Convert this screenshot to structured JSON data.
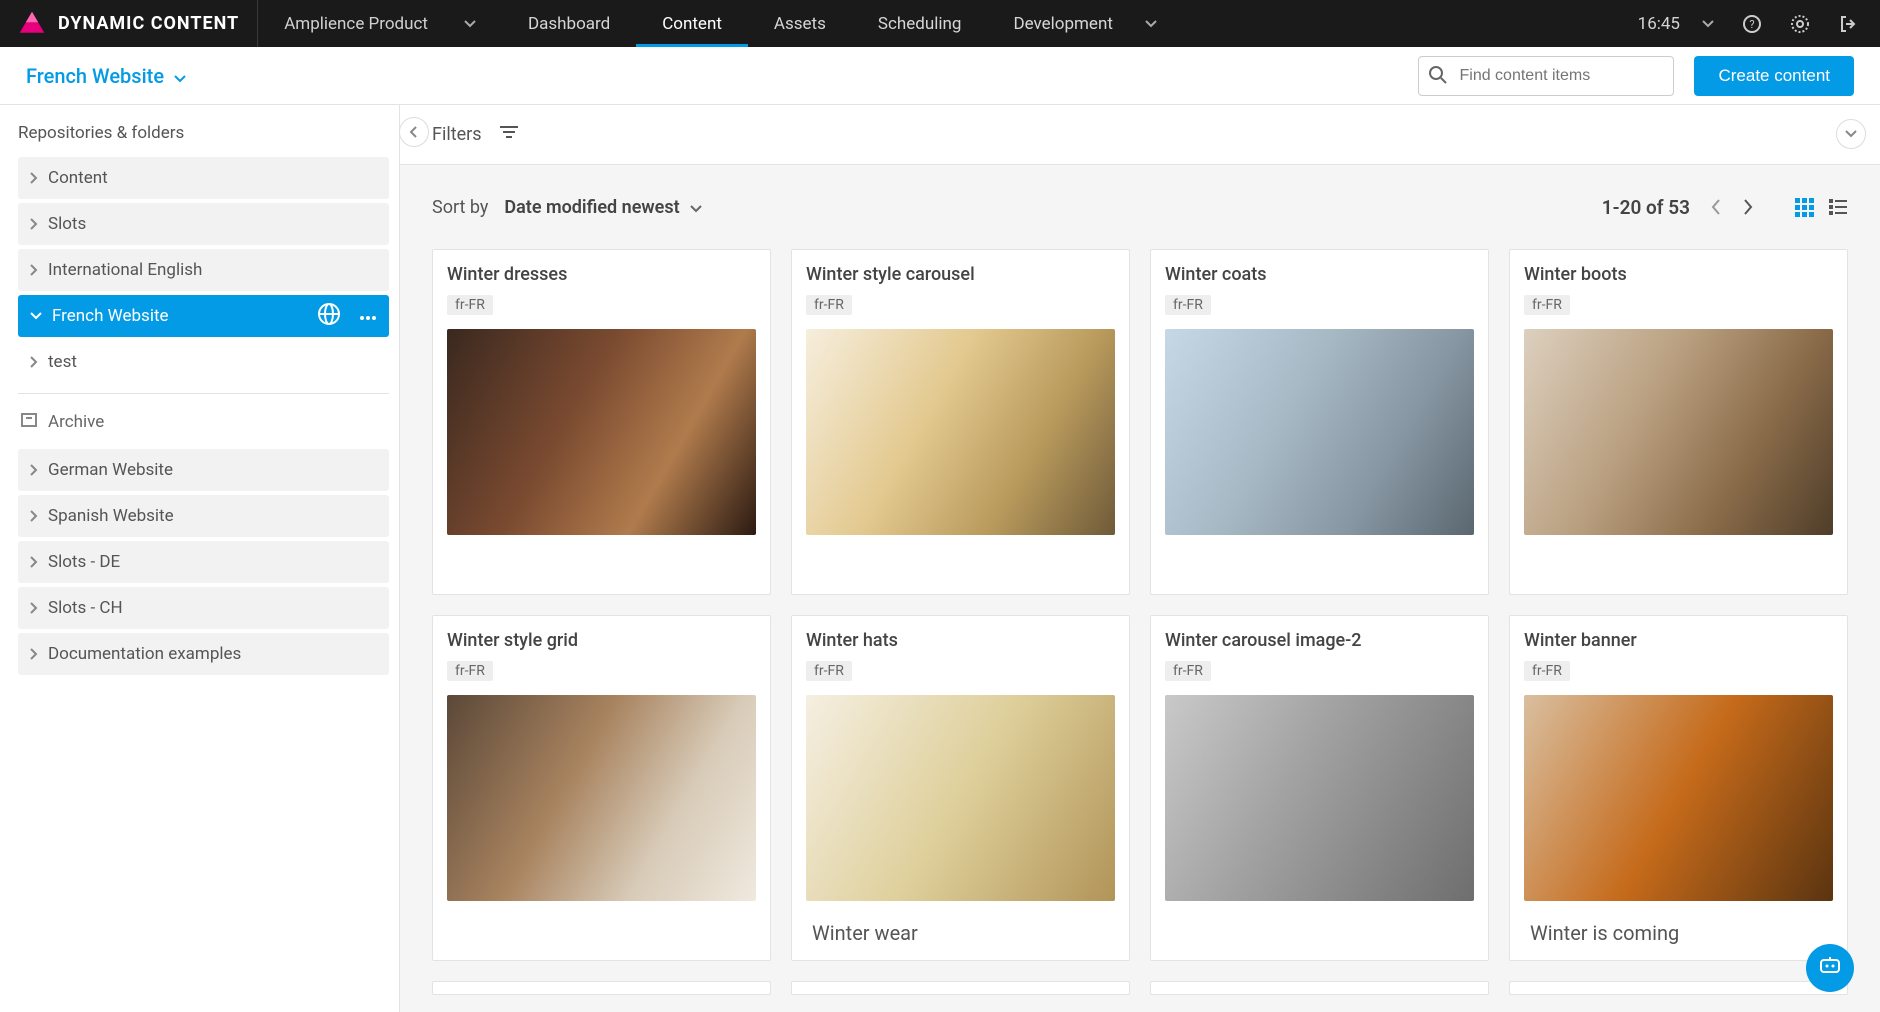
{
  "brand": "DYNAMIC CONTENT",
  "product_selector": "Amplience Product",
  "topnav": {
    "items": [
      "Dashboard",
      "Content",
      "Assets",
      "Scheduling",
      "Development"
    ],
    "active_index": 1
  },
  "top": {
    "time": "16:45"
  },
  "subheader": {
    "site": "French Website",
    "search_placeholder": "Find content items",
    "create_label": "Create content"
  },
  "sidebar": {
    "title": "Repositories & folders",
    "items": [
      {
        "label": "Content"
      },
      {
        "label": "Slots"
      },
      {
        "label": "International English"
      },
      {
        "label": "French Website",
        "active": true
      },
      {
        "label": "test"
      }
    ],
    "archive": "Archive",
    "groups": [
      {
        "label": "German Website"
      },
      {
        "label": "Spanish Website"
      },
      {
        "label": "Slots - DE"
      },
      {
        "label": "Slots - CH"
      },
      {
        "label": "Documentation examples"
      }
    ]
  },
  "filters": {
    "label": "Filters"
  },
  "sort": {
    "label": "Sort by",
    "value": "Date modified newest",
    "range": "1-20 of 53"
  },
  "locale_badge": "fr-FR",
  "cards": [
    {
      "title": "Winter dresses",
      "caption": ""
    },
    {
      "title": "Winter style carousel",
      "caption": ""
    },
    {
      "title": "Winter coats",
      "caption": ""
    },
    {
      "title": "Winter boots",
      "caption": ""
    },
    {
      "title": "Winter style grid",
      "caption": ""
    },
    {
      "title": "Winter hats",
      "caption": "Winter wear"
    },
    {
      "title": "Winter carousel image-2",
      "caption": ""
    },
    {
      "title": "Winter banner",
      "caption": "Winter is coming"
    }
  ]
}
